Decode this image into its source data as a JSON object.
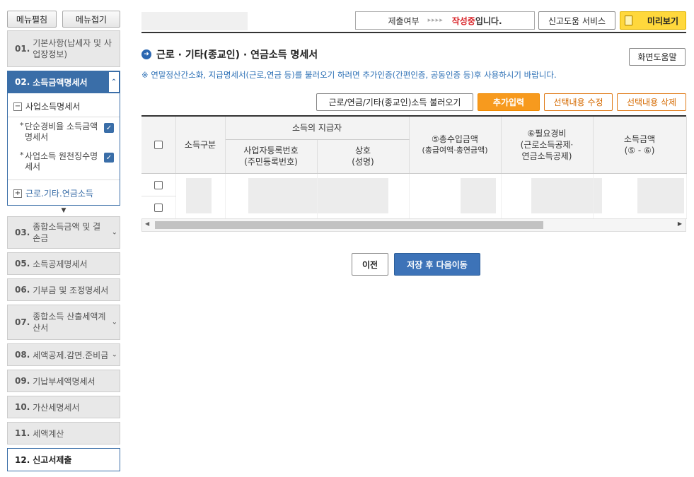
{
  "sidebar": {
    "expand_all": "메뉴펼침",
    "collapse_all": "메뉴접기",
    "steps": [
      {
        "num": "01.",
        "label": "기본사항(납세자 및 사업장정보)"
      },
      {
        "num": "02.",
        "label": "소득금액명세서"
      },
      {
        "num": "03.",
        "label": "종합소득금액 및 결손금"
      },
      {
        "num": "05.",
        "label": "소득공제명세서"
      },
      {
        "num": "06.",
        "label": "기부금 및 조정명세서"
      },
      {
        "num": "07.",
        "label": "종합소득 산출세액계산서"
      },
      {
        "num": "08.",
        "label": "세액공제.감면.준비금"
      },
      {
        "num": "09.",
        "label": "기납부세액명세서"
      },
      {
        "num": "10.",
        "label": "가산세명세서"
      },
      {
        "num": "11.",
        "label": "세액계산"
      },
      {
        "num": "12.",
        "label": "신고서제출"
      }
    ],
    "sub_group_1": "사업소득명세서",
    "sub_items": [
      "단순경비율 소득금액명세서",
      "사업소득 원천징수명세서"
    ],
    "sub_group_2": "근로.기타.연금소득"
  },
  "header": {
    "submit_label": "제출여부",
    "submit_arrows": "▸▸▸▸",
    "status_red": "작성중",
    "status_suffix": "입니다.",
    "help_service": "신고도움 서비스",
    "preview": "미리보기"
  },
  "page": {
    "title": "근로 · 기타(종교인) · 연금소득 명세서",
    "screen_help": "화면도움말",
    "notice": "※ 연말정산간소화, 지급명세서(근로,연금 등)를 불러오기 하려면 추가인증(간편인증, 공동인증 등)후 사용하시기 바랍니다."
  },
  "actions": {
    "load": "근로/연금/기타(종교인)소득 불러오기",
    "add": "추가입력",
    "edit": "선택내용 수정",
    "delete": "선택내용 삭제"
  },
  "table": {
    "col_type": "소득구분",
    "payer_group": "소득의 지급자",
    "biz_no_1": "사업자등록번호",
    "biz_no_2": "(주민등록번호)",
    "name_1": "상호",
    "name_2": "(성명)",
    "total_1": "⑤총수입금액",
    "total_2": "(총급여액·총연금액)",
    "exp_1": "⑥필요경비",
    "exp_2": "(근로소득공제·",
    "exp_3": "연금소득공제)",
    "income_1": "소득금액",
    "income_2": "(⑤ - ⑥)"
  },
  "nav": {
    "prev": "이전",
    "next": "저장 후 다음이동"
  }
}
